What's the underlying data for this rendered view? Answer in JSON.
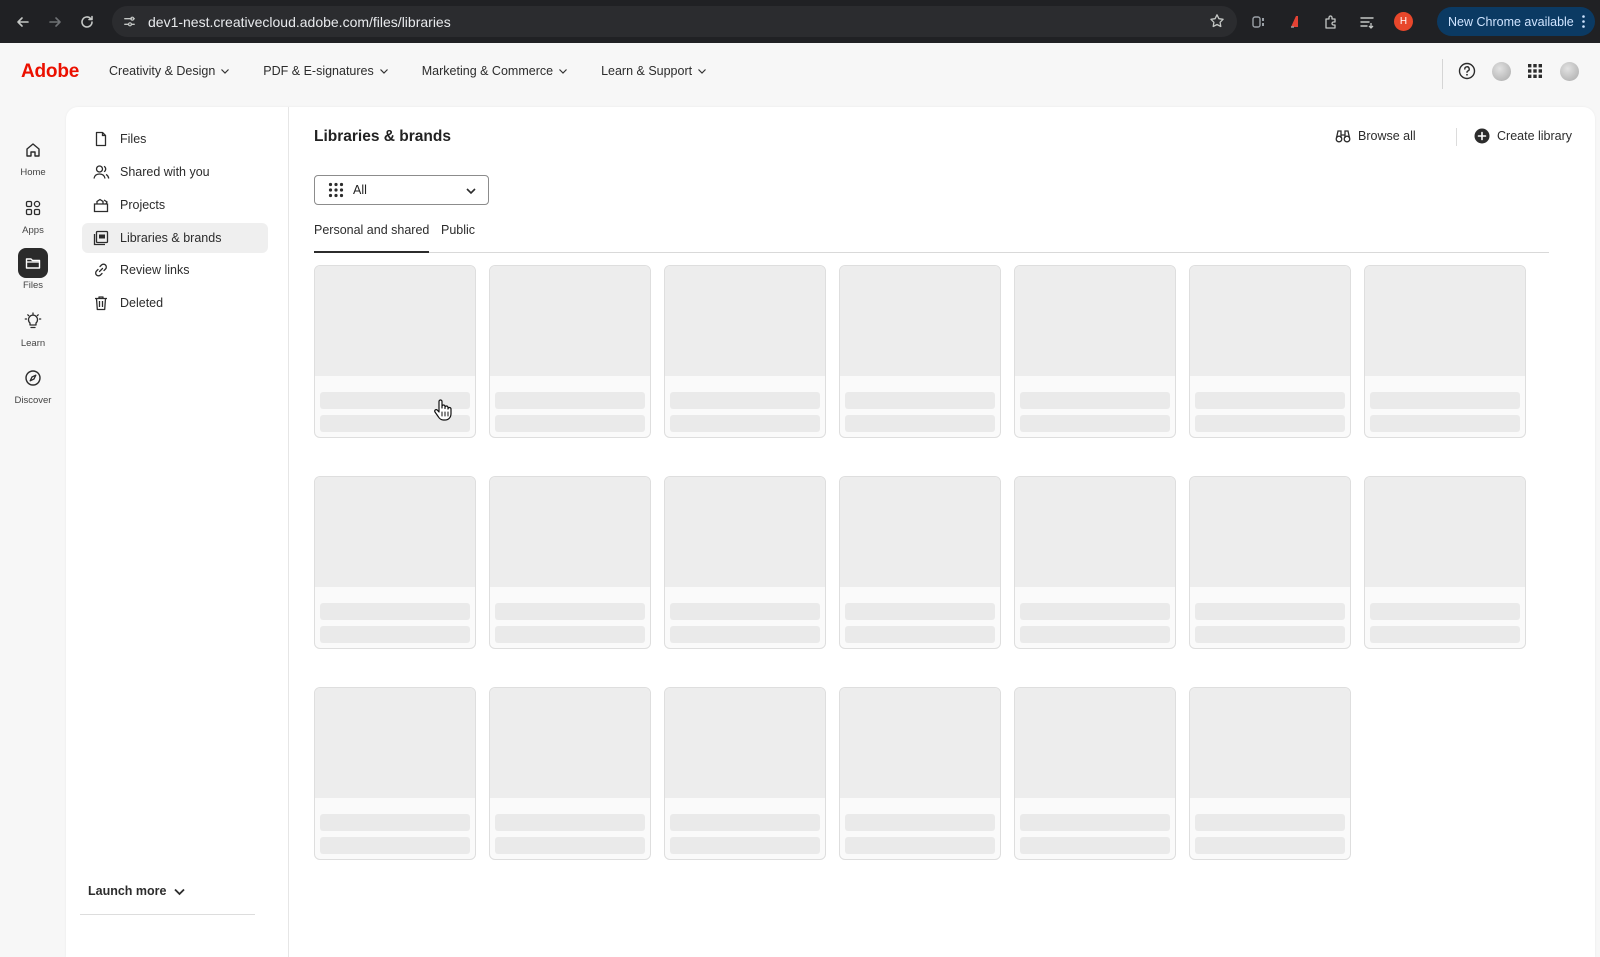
{
  "browser": {
    "url": "dev1-nest.creativecloud.adobe.com/files/libraries",
    "profile_initial": "H",
    "update_label": "New Chrome available"
  },
  "header": {
    "logo": "Adobe",
    "nav": [
      {
        "label": "Creativity & Design"
      },
      {
        "label": "PDF & E-signatures"
      },
      {
        "label": "Marketing & Commerce"
      },
      {
        "label": "Learn & Support"
      }
    ]
  },
  "rail": {
    "items": [
      {
        "label": "Home",
        "icon": "home-icon"
      },
      {
        "label": "Apps",
        "icon": "apps-icon"
      },
      {
        "label": "Files",
        "icon": "folder-icon",
        "active": true
      },
      {
        "label": "Learn",
        "icon": "lightbulb-icon"
      },
      {
        "label": "Discover",
        "icon": "compass-icon"
      }
    ]
  },
  "sidebar": {
    "items": [
      {
        "label": "Files",
        "icon": "file-icon"
      },
      {
        "label": "Shared with you",
        "icon": "people-icon"
      },
      {
        "label": "Projects",
        "icon": "projects-icon"
      },
      {
        "label": "Libraries & brands",
        "icon": "library-icon",
        "active": true
      },
      {
        "label": "Review links",
        "icon": "link-icon"
      },
      {
        "label": "Deleted",
        "icon": "trash-icon"
      }
    ],
    "launch_more": "Launch more"
  },
  "main": {
    "title": "Libraries & brands",
    "browse_all": "Browse all",
    "create_library": "Create library",
    "filter": {
      "selected": "All"
    },
    "tabs": [
      {
        "label": "Personal and shared",
        "active": true
      },
      {
        "label": "Public"
      }
    ],
    "placeholder_cards": 20
  },
  "colors": {
    "adobe_red": "#eb1000",
    "chrome_bg": "#202124",
    "update_pill": "#0b3a63",
    "profile": "#e8472b"
  }
}
